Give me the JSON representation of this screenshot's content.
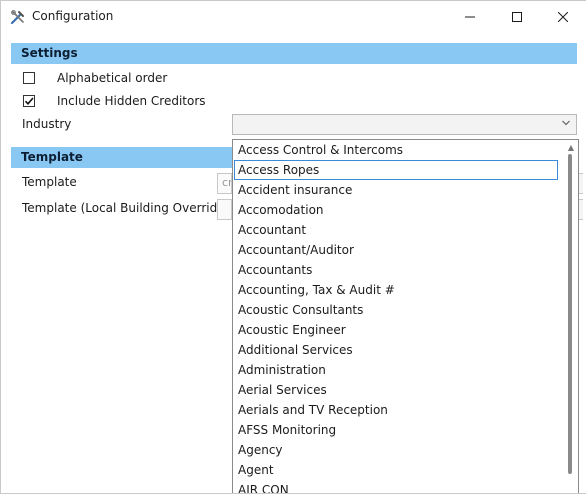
{
  "window": {
    "title": "Configuration",
    "icon": "tools-icon",
    "buttons": {
      "minimize": "minimize-icon",
      "maximize": "maximize-icon",
      "close": "close-icon"
    }
  },
  "settings": {
    "header": "Settings",
    "alphabetical_order": {
      "label": "Alphabetical order",
      "checked": false
    },
    "include_hidden_creditors": {
      "label": "Include Hidden Creditors",
      "checked": true
    },
    "industry_label": "Industry",
    "industry_value": ""
  },
  "template_section": {
    "header": "Template",
    "template_label": "Template",
    "template_value": "cr",
    "template_local_label": "Template (Local Building Override)",
    "template_local_value": ""
  },
  "industry_dropdown": {
    "selected": "Access Ropes",
    "items": [
      "Access Control & Intercoms",
      "Access Ropes",
      "Accident insurance",
      "Accomodation",
      "Accountant",
      "Accountant/Auditor",
      "Accountants",
      "Accounting, Tax & Audit #",
      "Acoustic Consultants",
      "Acoustic Engineer",
      "Additional Services",
      "Administration",
      "Aerial Services",
      "Aerials and TV Reception",
      "AFSS Monitoring",
      "Agency",
      "Agent",
      "AIR CON"
    ]
  },
  "colors": {
    "section_header": "#8ac8f4",
    "selection_border": "#3a8ad6"
  }
}
